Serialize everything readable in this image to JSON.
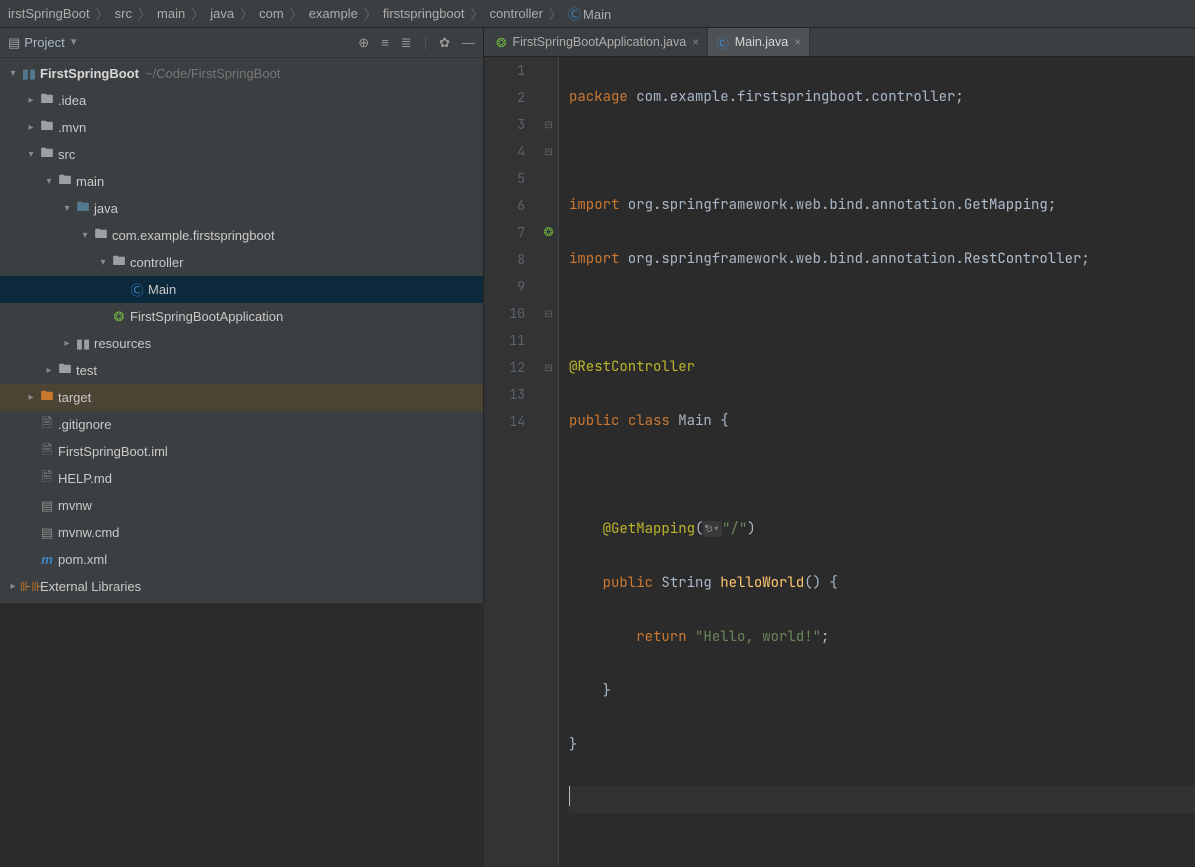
{
  "breadcrumbs": {
    "items": [
      "irstSpringBoot",
      "src",
      "main",
      "java",
      "com",
      "example",
      "firstspringboot",
      "controller"
    ],
    "last": "Main"
  },
  "projectPanel": {
    "title": "Project"
  },
  "tree": {
    "rootName": "FirstSpringBoot",
    "rootPath": "~/Code/FirstSpringBoot",
    "idea": ".idea",
    "mvn": ".mvn",
    "src": "src",
    "main": "main",
    "java": "java",
    "pkg": "com.example.firstspringboot",
    "controller": "controller",
    "mainClass": "Main",
    "appClass": "FirstSpringBootApplication",
    "resources": "resources",
    "test": "test",
    "target": "target",
    "gitignore": ".gitignore",
    "iml": "FirstSpringBoot.iml",
    "help": "HELP.md",
    "mvnw": "mvnw",
    "mvnwcmd": "mvnw.cmd",
    "pom": "pom.xml",
    "externalLibs": "External Libraries"
  },
  "tabs": {
    "tab1": "FirstSpringBootApplication.java",
    "tab2": "Main.java"
  },
  "code": {
    "l1_kw": "package",
    "l1_rest": " com.example.firstspringboot.controller;",
    "l3_kw": "import",
    "l3_rest": " org.springframework.web.bind.annotation.",
    "l3_cls": "GetMapping",
    "l4_kw": "import",
    "l4_rest": " org.springframework.web.bind.annotation.",
    "l4_cls": "RestController",
    "l6_ann": "@RestController",
    "l7_kw1": "public",
    "l7_kw2": "class",
    "l7_name": "Main",
    "l9_ann": "@GetMapping",
    "l9_hint": "⎋▾",
    "l9_str": "\"/\"",
    "l10_kw": "public",
    "l10_typ": "String",
    "l10_fn": "helloWorld",
    "l11_kw": "return",
    "l11_str": "\"Hello, world!\""
  },
  "lineNumbers": [
    "1",
    "2",
    "3",
    "4",
    "5",
    "6",
    "7",
    "8",
    "9",
    "10",
    "11",
    "12",
    "13",
    "14"
  ]
}
